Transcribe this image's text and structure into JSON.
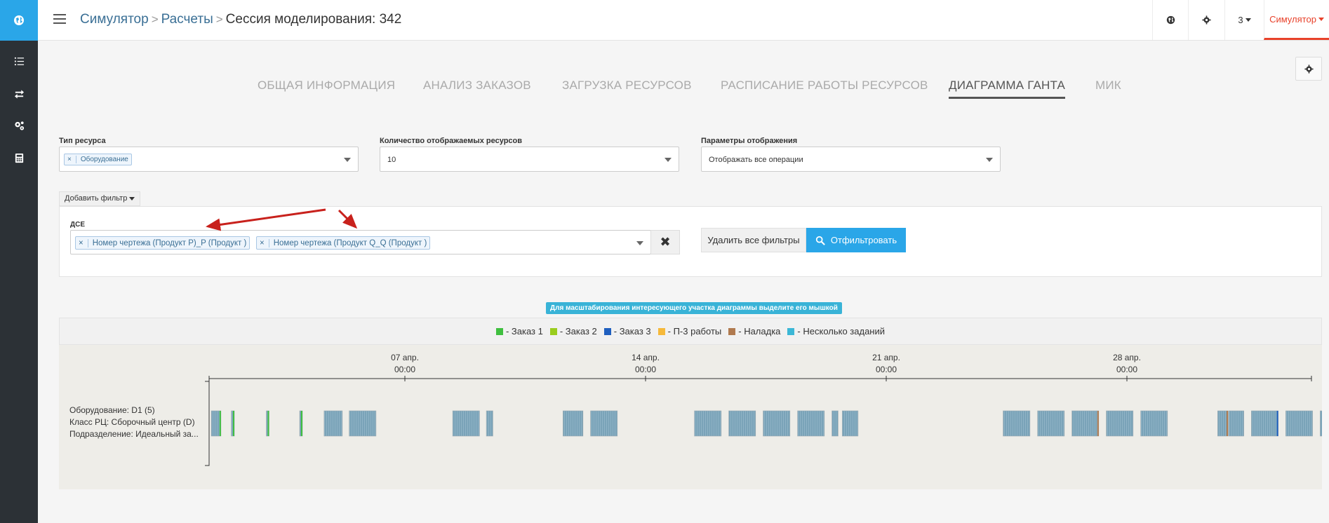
{
  "sidebar": {
    "items": [
      {
        "icon": "globe-icon"
      },
      {
        "icon": "list-icon"
      },
      {
        "icon": "exchange-icon"
      },
      {
        "icon": "cogs-icon"
      },
      {
        "icon": "calculator-icon"
      }
    ]
  },
  "breadcrumb": {
    "root": "Симулятор",
    "parent": "Расчеты",
    "current": "Сессия моделирования: 342"
  },
  "topbar": {
    "globe_icon": "globe-icon",
    "gear_icon": "gear-icon",
    "count_label": "3",
    "user_label": "Симулятор",
    "accent": "#e8412a"
  },
  "tabs": [
    {
      "label": "ОБЩАЯ ИНФОРМАЦИЯ",
      "active": false
    },
    {
      "label": "АНАЛИЗ ЗАКАЗОВ",
      "active": false
    },
    {
      "label": "ЗАГРУЗКА РЕСУРСОВ",
      "active": false
    },
    {
      "label": "РАСПИСАНИЕ РАБОТЫ РЕСУРСОВ",
      "active": false
    },
    {
      "label": "ДИАГРАММА ГАНТА",
      "active": true
    },
    {
      "label": "МИК",
      "active": false
    }
  ],
  "filters": {
    "resource_type": {
      "label": "Тип ресурса",
      "tag": "Оборудование"
    },
    "resource_count": {
      "label": "Количество отображаемых ресурсов",
      "value": "10"
    },
    "display_params": {
      "label": "Параметры отображения",
      "value": "Отображать все операции"
    },
    "add_filter": "Добавить фильтр"
  },
  "dse": {
    "label": "ДСЕ",
    "tags": [
      "Номер чертежа (Продукт P)_P (Продукт )",
      "Номер чертежа (Продукт Q_Q (Продукт )"
    ],
    "clear": "✖"
  },
  "buttons": {
    "remove_all": "Удалить все фильтры",
    "apply": "Отфильтровать",
    "primary_color": "#2aa6e8"
  },
  "hint": "Для масштабирования интересующего участка диаграммы выделите его мышкой",
  "legend": [
    {
      "label": "- Заказ 1",
      "color": "#3fbf3f"
    },
    {
      "label": "- Заказ 2",
      "color": "#9acd1e"
    },
    {
      "label": "- Заказ 3",
      "color": "#1f5fbf"
    },
    {
      "label": "- П-3 работы",
      "color": "#f6b93b"
    },
    {
      "label": "- Наладка",
      "color": "#b07a4f"
    },
    {
      "label": "- Несколько заданий",
      "color": "#3bb7d6"
    }
  ],
  "gantt": {
    "ticks": [
      {
        "date": "07 апр.",
        "time": "00:00",
        "day": 7
      },
      {
        "date": "14 апр.",
        "time": "00:00",
        "day": 14
      },
      {
        "date": "21 апр.",
        "time": "00:00",
        "day": 21
      },
      {
        "date": "28 апр.",
        "time": "00:00",
        "day": 28
      }
    ],
    "row": {
      "line1": "Оборудование: D1 (5)",
      "line2": "Класс РЦ: Сборочный центр (D)",
      "line3": "Подразделение: Идеальный за..."
    },
    "multi_color": "#7aa3b8",
    "start_day": 1.35,
    "end_day": 33.4,
    "bars": [
      {
        "start": 1.37,
        "end": 1.65,
        "color": "#7aa3b8",
        "edge": "#3fbf3f"
      },
      {
        "start": 1.95,
        "end": 2.04,
        "color": "#7aa3b8",
        "edge": "#3fbf3f"
      },
      {
        "start": 2.97,
        "end": 3.05,
        "color": "#7aa3b8",
        "edge": "#3fbf3f"
      },
      {
        "start": 3.94,
        "end": 4.02,
        "color": "#7aa3b8",
        "edge": "#3fbf3f"
      },
      {
        "start": 4.65,
        "end": 5.18,
        "color": "#7aa3b8"
      },
      {
        "start": 5.38,
        "end": 6.16,
        "color": "#7aa3b8"
      },
      {
        "start": 8.39,
        "end": 9.17,
        "color": "#7aa3b8"
      },
      {
        "start": 9.37,
        "end": 9.56,
        "color": "#7aa3b8"
      },
      {
        "start": 11.6,
        "end": 12.18,
        "color": "#7aa3b8"
      },
      {
        "start": 12.4,
        "end": 13.18,
        "color": "#7aa3b8"
      },
      {
        "start": 15.42,
        "end": 16.2,
        "color": "#7aa3b8"
      },
      {
        "start": 16.42,
        "end": 17.2,
        "color": "#7aa3b8"
      },
      {
        "start": 17.42,
        "end": 18.2,
        "color": "#7aa3b8"
      },
      {
        "start": 18.42,
        "end": 19.2,
        "color": "#7aa3b8"
      },
      {
        "start": 19.42,
        "end": 19.6,
        "color": "#7aa3b8"
      },
      {
        "start": 19.72,
        "end": 20.18,
        "color": "#7aa3b8"
      },
      {
        "start": 24.4,
        "end": 25.18,
        "color": "#7aa3b8"
      },
      {
        "start": 25.4,
        "end": 26.18,
        "color": "#7aa3b8"
      },
      {
        "start": 26.4,
        "end": 27.18,
        "color": "#7aa3b8",
        "edge": "#b07a4f"
      },
      {
        "start": 27.4,
        "end": 28.18,
        "color": "#7aa3b8"
      },
      {
        "start": 28.4,
        "end": 29.18,
        "color": "#7aa3b8"
      },
      {
        "start": 30.64,
        "end": 30.94,
        "color": "#7aa3b8",
        "edge": "#b07a4f"
      },
      {
        "start": 30.96,
        "end": 31.4,
        "color": "#7aa3b8"
      },
      {
        "start": 31.62,
        "end": 32.4,
        "color": "#7aa3b8",
        "edge": "#1f5fbf"
      },
      {
        "start": 32.62,
        "end": 33.4,
        "color": "#7aa3b8"
      },
      {
        "start": 33.62,
        "end": 34.4,
        "color": "#7aa3b8"
      }
    ]
  }
}
